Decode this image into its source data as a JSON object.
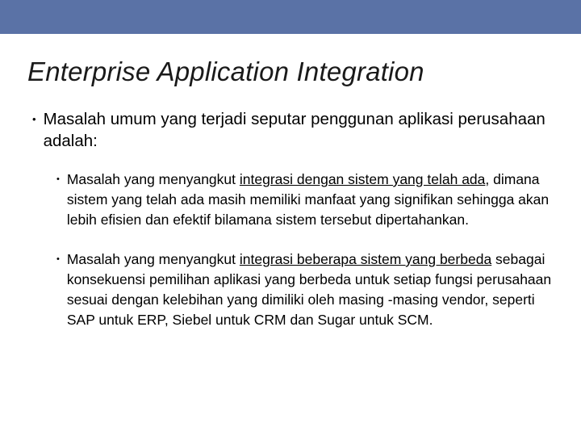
{
  "slide": {
    "title": "Enterprise Application Integration",
    "main": {
      "text_a": "Masalah umum yang terjadi seputar penggunan aplikasi ",
      "text_b": "perusahaan adalah:"
    },
    "sub": [
      {
        "pre": "Masalah yang menyangkut ",
        "u": "integrasi dengan sistem yang telah ada",
        "post": ", dimana sistem yang telah ada masih memiliki manfaat yang signifikan sehingga akan lebih efisien dan efektif bilamana sistem tersebut dipertahankan."
      },
      {
        "pre": "Masalah yang menyangkut ",
        "u": "integrasi beberapa sistem yang berbeda",
        "post": " sebagai konsekuensi pemilihan aplikasi yang berbeda untuk setiap fungsi perusahaan sesuai dengan kelebihan yang dimiliki oleh masing -masing vendor, seperti SAP untuk ERP, Siebel untuk CRM dan Sugar untuk SCM."
      }
    ]
  }
}
